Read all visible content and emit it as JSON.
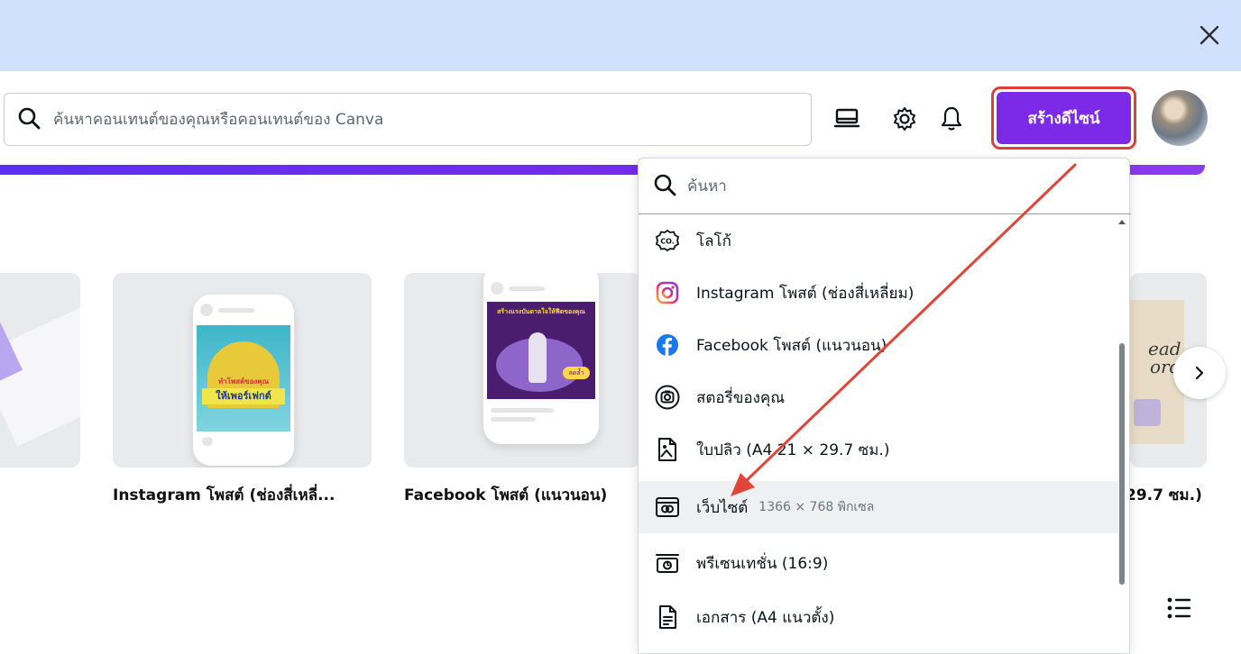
{
  "banner": {
    "close_icon": "close-icon"
  },
  "header": {
    "search_placeholder": "ค้นหาคอนเทนต์ของคุณหรือคอนเทนต์ของ Canva",
    "icons": [
      "search-icon",
      "desktop-icon",
      "gear-icon",
      "bell-icon"
    ],
    "create_label": "สร้างดีไซน์",
    "accent_color": "#7d2ae8"
  },
  "cards": [
    {
      "label": "Instagram โพสต์ (ช่องสี่เหลี่...",
      "art_text_1": "ทำโพสต์ของคุณ",
      "art_text_2": "ให้เพอร์เฟกต์"
    },
    {
      "label": "Facebook โพสต์ (แนวนอน)",
      "art_text_1": "สร้างแรงบันดาลใจให้ฟีดของคุณ",
      "art_text_2": "ลดล้ำ"
    },
    {
      "label": "29.7 ซม.)",
      "art_text_1": "ead",
      "art_text_2": "ord"
    }
  ],
  "dropdown": {
    "search_placeholder": "ค้นหา",
    "items": [
      {
        "icon": "logo-icon",
        "label": "โลโก้",
        "sub": ""
      },
      {
        "icon": "instagram-icon",
        "label": "Instagram โพสต์ (ช่องสี่เหลี่ยม)",
        "sub": ""
      },
      {
        "icon": "facebook-icon",
        "label": "Facebook โพสต์ (แนวนอน)",
        "sub": ""
      },
      {
        "icon": "story-icon",
        "label": "สตอรี่ของคุณ",
        "sub": ""
      },
      {
        "icon": "flyer-icon",
        "label": "ใบปลิว (A4 21 × 29.7 ซม.)",
        "sub": ""
      },
      {
        "icon": "website-icon",
        "label": "เว็บไซต์",
        "sub": "1366 × 768 พิกเซล"
      },
      {
        "icon": "presentation-icon",
        "label": "พรีเซนเทชั่น (16:9)",
        "sub": ""
      },
      {
        "icon": "document-icon",
        "label": "เอกสาร (A4 แนวตั้ง)",
        "sub": ""
      }
    ]
  },
  "annotation": {
    "arrow_color": "#e0453a"
  }
}
